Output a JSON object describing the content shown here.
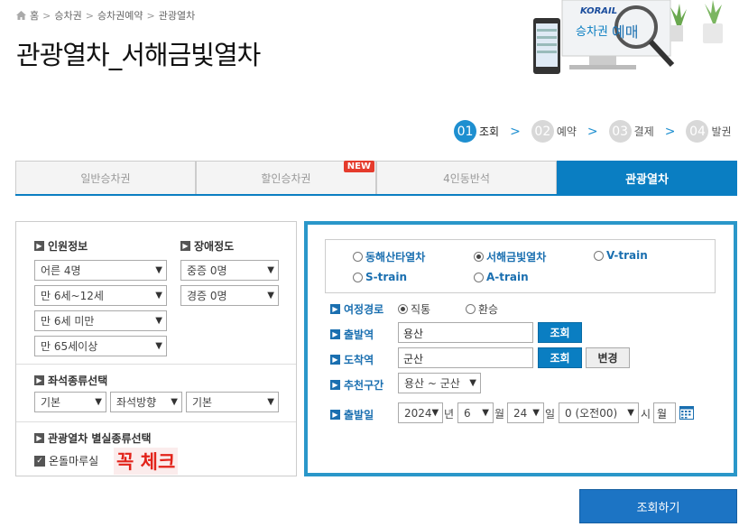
{
  "breadcrumb": {
    "home": "홈",
    "items": [
      "승차권",
      "승차권예약",
      "관광열차"
    ],
    "sep": ">"
  },
  "page_title": "관광열차_서해금빛열차",
  "banner": {
    "brand": "KORAIL",
    "text1": "승차권",
    "text2": "예매"
  },
  "steps": [
    {
      "num": "01",
      "label": "조회"
    },
    {
      "num": "02",
      "label": "예약"
    },
    {
      "num": "03",
      "label": "결제"
    },
    {
      "num": "04",
      "label": "발권"
    }
  ],
  "step_arrow": ">",
  "tabs": [
    {
      "label": "일반승차권"
    },
    {
      "label": "할인승차권",
      "badge": "NEW"
    },
    {
      "label": "4인동반석"
    },
    {
      "label": "관광열차"
    }
  ],
  "left": {
    "passenger_title": "인원정보",
    "passengers": [
      "어른 4명",
      "만 6세~12세",
      "만 6세 미만",
      "만 65세이상"
    ],
    "disability_title": "장애정도",
    "disability": [
      "중증 0명",
      "경증 0명"
    ],
    "seat_title": "좌석종류선택",
    "seat_opts": [
      "기본",
      "좌석방향",
      "기본"
    ],
    "room_title": "관광열차 별실종류선택",
    "room_check": "온돌마루실",
    "note": "꼭 체크"
  },
  "right": {
    "trains": [
      "동해산타열차",
      "서해금빛열차",
      "V-train",
      "S-train",
      "A-train"
    ],
    "route_label": "여정경로",
    "route_opts": [
      "직통",
      "환승"
    ],
    "dep_label": "출발역",
    "dep_value": "용산",
    "arr_label": "도착역",
    "arr_value": "군산",
    "search_btn": "조회",
    "change_btn": "변경",
    "rec_label": "추천구간",
    "rec_value": "용산 ~ 군산",
    "date_label": "출발일",
    "year": "2024",
    "year_u": "년",
    "month": "6",
    "month_u": "월",
    "day": "24",
    "day_u": "일",
    "hour": "0 (오전00)",
    "hour_u": "시",
    "weekday": "월"
  },
  "submit": "조회하기",
  "colors": {
    "accent": "#0a7ec2",
    "frame": "#2a97c9",
    "red": "#e2231a"
  }
}
